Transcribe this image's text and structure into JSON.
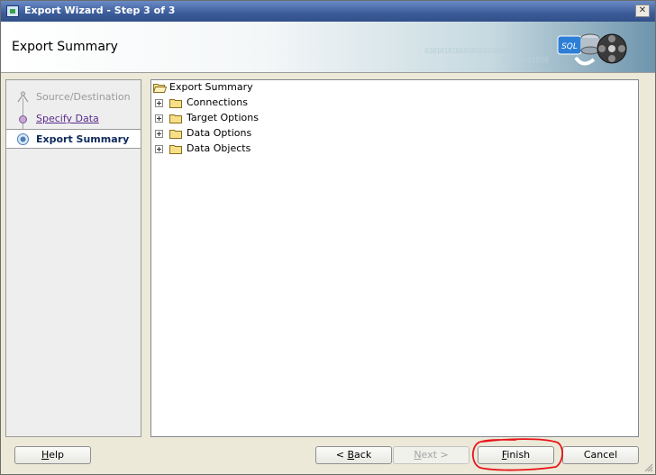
{
  "window": {
    "title": "Export Wizard - Step 3 of 3",
    "close_glyph": "✕"
  },
  "header": {
    "title": "Export Summary",
    "decoration_text": "0101010101010101010101010",
    "decoration_text2": "01010101010",
    "graphic_label": "SQL"
  },
  "nav": {
    "steps": [
      {
        "label": "Source/Destination",
        "state": "done"
      },
      {
        "label": "Specify Data",
        "state": "link"
      },
      {
        "label": "Export Summary",
        "state": "current"
      }
    ]
  },
  "tree": {
    "root": "Export Summary",
    "children": [
      "Connections",
      "Target Options",
      "Data Options",
      "Data Objects"
    ]
  },
  "buttons": {
    "help": {
      "mnemonic": "H",
      "rest": "elp"
    },
    "back": {
      "prefix": "< ",
      "mnemonic": "B",
      "rest": "ack"
    },
    "next": {
      "mnemonic": "N",
      "rest": "ext >"
    },
    "finish": {
      "mnemonic": "F",
      "rest": "inish"
    },
    "cancel": {
      "label": "Cancel"
    }
  },
  "annotation": {
    "color": "#e8141b"
  }
}
